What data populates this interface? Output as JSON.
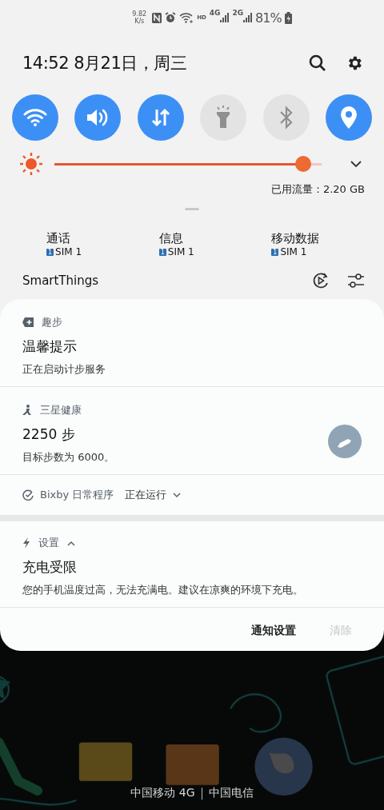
{
  "status_bar": {
    "net_speed": "9.82",
    "net_speed_unit": "K/s",
    "hd": "HD",
    "signals": [
      {
        "label": "4G"
      },
      {
        "label": "2G"
      }
    ],
    "battery": "81%"
  },
  "header": {
    "datetime": "14:52 8月21日，周三"
  },
  "toggles": [
    {
      "kind": "wifi",
      "on": true
    },
    {
      "kind": "sound",
      "on": true
    },
    {
      "kind": "data",
      "on": true
    },
    {
      "kind": "flashlight",
      "on": false
    },
    {
      "kind": "bluetooth",
      "on": false
    },
    {
      "kind": "location",
      "on": true
    }
  ],
  "brightness": {
    "level": 0.93
  },
  "data_usage": "已用流量：2.20 GB",
  "sim_settings": [
    {
      "label": "通话",
      "badge": "1",
      "sim": "SIM 1"
    },
    {
      "label": "信息",
      "badge": "1",
      "sim": "SIM 1"
    },
    {
      "label": "移动数据",
      "badge": "1",
      "sim": "SIM 1"
    }
  ],
  "smartthings": "SmartThings",
  "notifications": [
    {
      "kind": "steps_app",
      "app": "趣步",
      "title": "温馨提示",
      "body": "正在启动计步服务"
    },
    {
      "kind": "health",
      "app": "三星健康",
      "title": "2250 步",
      "body": "目标步数为 6000。"
    }
  ],
  "routine": {
    "app": "Bixby 日常程序",
    "status": "正在运行",
    "expanded": false
  },
  "alert": {
    "app": "设置",
    "expanded": true,
    "title": "充电受限",
    "body": "您的手机温度过高，无法充满电。建议在凉爽的环境下充电。"
  },
  "actions": [
    {
      "label": "通知设置",
      "disabled": false
    },
    {
      "label": "清除",
      "disabled": true
    }
  ],
  "carriers": [
    "中国移动 4G",
    "中国电信"
  ]
}
